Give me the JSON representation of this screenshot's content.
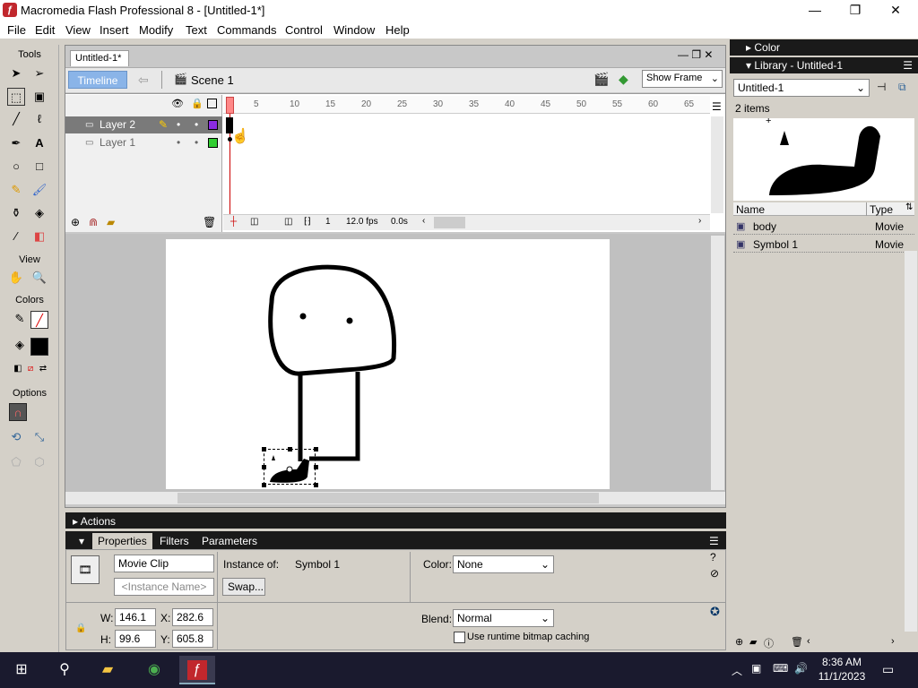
{
  "window": {
    "title": "Macromedia Flash Professional 8 - [Untitled-1*]",
    "minimize": "—",
    "maximize": "❐",
    "close": "✕"
  },
  "menu": [
    "File",
    "Edit",
    "View",
    "Insert",
    "Modify",
    "Text",
    "Commands",
    "Control",
    "Window",
    "Help"
  ],
  "tools": {
    "tools_label": "Tools",
    "view_label": "View",
    "colors_label": "Colors",
    "options_label": "Options"
  },
  "document": {
    "tab": "Untitled-1*",
    "timeline_button": "Timeline",
    "scene": "Scene 1",
    "show_frame": "Show Frame"
  },
  "timeline": {
    "layers": [
      {
        "name": "Layer 2",
        "color": "#8a2be2"
      },
      {
        "name": "Layer 1",
        "color": "#32cd32"
      }
    ],
    "ruler": [
      "1",
      "5",
      "10",
      "15",
      "20",
      "25",
      "30",
      "35",
      "40",
      "45",
      "50",
      "55",
      "60",
      "65"
    ],
    "current_frame": "1",
    "fps": "12.0 fps",
    "elapsed": "0.0s"
  },
  "actions_label": "Actions",
  "properties": {
    "tabs": [
      "Properties",
      "Filters",
      "Parameters"
    ],
    "symbol_type": "Movie Clip",
    "instance_placeholder": "<Instance Name>",
    "instance_of_label": "Instance of:",
    "instance_of_value": "Symbol 1",
    "swap": "Swap...",
    "color_label": "Color:",
    "color_value": "None",
    "blend_label": "Blend:",
    "blend_value": "Normal",
    "cache_label": "Use runtime bitmap caching",
    "w_label": "W:",
    "w": "146.1",
    "x_label": "X:",
    "x": "282.6",
    "h_label": "H:",
    "h": "99.6",
    "y_label": "Y:",
    "y": "605.8"
  },
  "right": {
    "color_panel": "Color",
    "library_panel": "Library - Untitled-1",
    "library_doc": "Untitled-1",
    "item_count": "2 items",
    "col_name": "Name",
    "col_type": "Type",
    "items": [
      {
        "name": "body",
        "type": "Movie"
      },
      {
        "name": "Symbol 1",
        "type": "Movie"
      }
    ]
  },
  "clock": {
    "time": "8:36 AM",
    "date": "11/1/2023"
  }
}
